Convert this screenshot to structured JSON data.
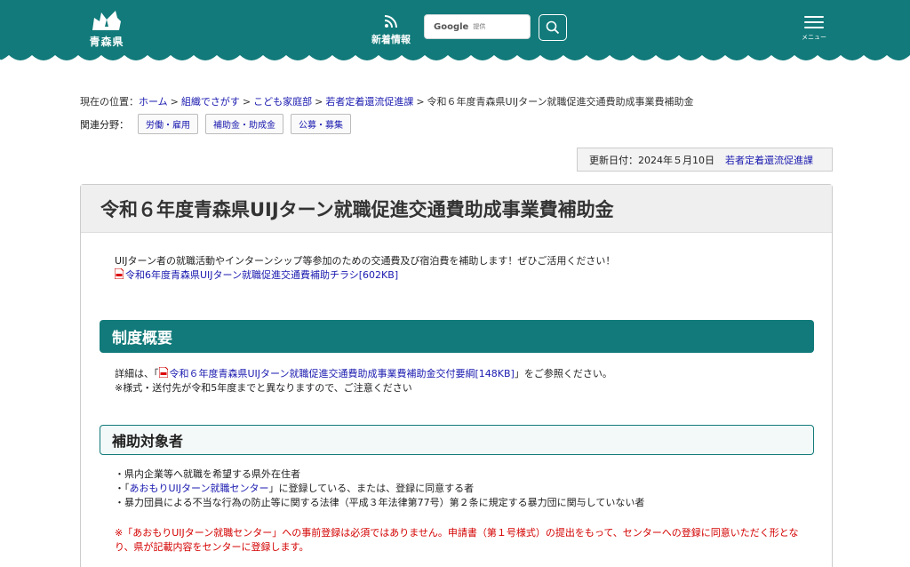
{
  "header": {
    "logo_text": "青森県",
    "news_label": "新着情報",
    "search": {
      "google": "Google",
      "provided": "提供"
    },
    "menu_label": "メニュー",
    "colors": {
      "primary": "#127a7a"
    }
  },
  "breadcrumb": {
    "prefix": "現在の位置：",
    "items": [
      "ホーム",
      "組織でさがす",
      "こども家庭部",
      "若者定着還流促進課"
    ],
    "current": "令和６年度青森県UIJターン就職促進交通費助成事業費補助金"
  },
  "related": {
    "label": "関連分野：",
    "tags": [
      "労働・雇用",
      "補助金・助成金",
      "公募・募集"
    ]
  },
  "updated": {
    "text": "更新日付：2024年５月10日",
    "dept": "若者定着還流促進課"
  },
  "page": {
    "title": "令和６年度青森県UIJターン就職促進交通費助成事業費補助金",
    "intro_text": "UIJターン者の就職活動やインターンシップ等参加のための交通費及び宿泊費を補助します！ぜひご活用ください！",
    "intro_link": "令和6年度青森県UIJターン就職促進交通費補助チラシ[602KB]"
  },
  "section1": {
    "title": "制度概要",
    "detail_prefix": "詳細は、「",
    "detail_link": "令和６年度青森県UIJターン就職促進交通費助成事業費補助金交付要綱[148KB]",
    "detail_suffix": "」をご参照ください。",
    "note": "※様式・送付先が令和5年度までと異なりますので、ご注意ください"
  },
  "section2": {
    "title": "補助対象者",
    "item1": "・県内企業等へ就職を希望する県外在住者",
    "item2_prefix": "・「",
    "item2_link": "あおもりUIJターン就職センター",
    "item2_suffix": "」に登録している、または、登録に同意する者",
    "item3": "・暴力団員による不当な行為の防止等に関する法律（平成３年法律第77号）第２条に規定する暴力団に関与していない者",
    "warning": "※「あおもりUIJターン就職センター」への事前登録は必須ではありません。申請書（第１号様式）の提出をもって、センターへの登録に同意いただく形となり、県が記載内容をセンターに登録します。"
  }
}
